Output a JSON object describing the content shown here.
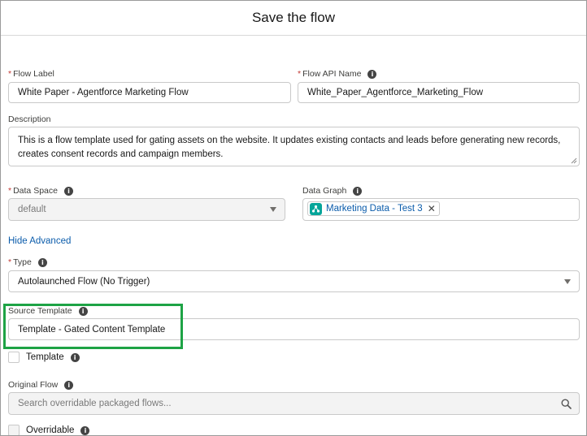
{
  "modal": {
    "title": "Save the flow"
  },
  "flow_label": {
    "label": "Flow Label",
    "value": "White Paper - Agentforce Marketing Flow",
    "required_mark": "*"
  },
  "flow_api_name": {
    "label": "Flow API Name",
    "value": "White_Paper_Agentforce_Marketing_Flow",
    "required_mark": "*",
    "info_icon": "info-icon"
  },
  "description": {
    "label": "Description",
    "line1": "This is a flow template used for gating assets on the website. It updates existing contacts and leads before generating new records,",
    "line2": "creates consent records and campaign members."
  },
  "data_space": {
    "label": "Data Space",
    "value": "default",
    "required_mark": "*",
    "info_icon": "info-icon"
  },
  "data_graph": {
    "label": "Data Graph",
    "pill_label": "Marketing Data - Test 3",
    "remove_glyph": "✕",
    "info_icon": "info-icon",
    "pill_icon_color": "#06a59a"
  },
  "advanced": {
    "toggle_label": "Hide Advanced"
  },
  "type": {
    "label": "Type",
    "value": "Autolaunched Flow (No Trigger)",
    "required_mark": "*",
    "info_icon": "info-icon"
  },
  "source_template": {
    "label": "Source Template",
    "value": "Template - Gated Content Template",
    "info_icon": "info-icon",
    "highlight_color": "#1ea345"
  },
  "template_checkbox": {
    "label": "Template",
    "checked": false
  },
  "original_flow": {
    "label": "Original Flow",
    "placeholder": "Search overridable packaged flows...",
    "icon": "search-icon"
  },
  "overridable_checkbox": {
    "label": "Overridable",
    "checked": false
  },
  "colors": {
    "link": "#0b5cab",
    "required": "#c23934",
    "border": "#c9c9c9",
    "disabled_bg": "#f3f3f3"
  }
}
